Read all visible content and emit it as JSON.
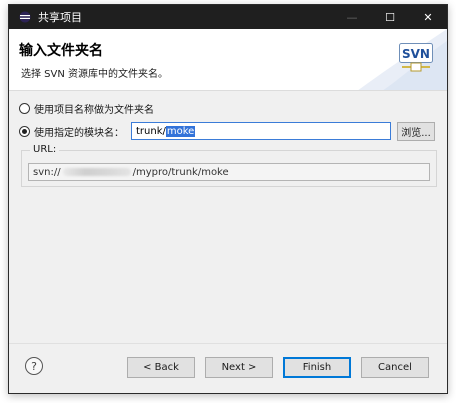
{
  "window": {
    "title": "共享项目",
    "controls": {
      "minimize": "—",
      "maximize": "☐",
      "close": "✕"
    }
  },
  "header": {
    "title": "输入文件夹名",
    "description": "选择 SVN 资源库中的文件夹名。",
    "logo_text": "SVN"
  },
  "options": {
    "use_project_name": {
      "label": "使用项目名称做为文件夹名",
      "checked": false
    },
    "use_module_name": {
      "label": "使用指定的模块名：",
      "checked": true
    }
  },
  "module_input": {
    "prefix": "trunk/",
    "selected": "moke"
  },
  "browse_label": "浏览...",
  "url": {
    "label": "URL:",
    "prefix": "svn://",
    "suffix": "/mypro/trunk/moke"
  },
  "buttons": {
    "help": "?",
    "back": "< Back",
    "next": "Next >",
    "finish": "Finish",
    "cancel": "Cancel"
  },
  "icons": {
    "app": "eclipse-icon",
    "help": "question-icon"
  },
  "colors": {
    "titlebar": "#1f1f1f",
    "selection": "#3373d9",
    "focus_border": "#0078d7"
  }
}
